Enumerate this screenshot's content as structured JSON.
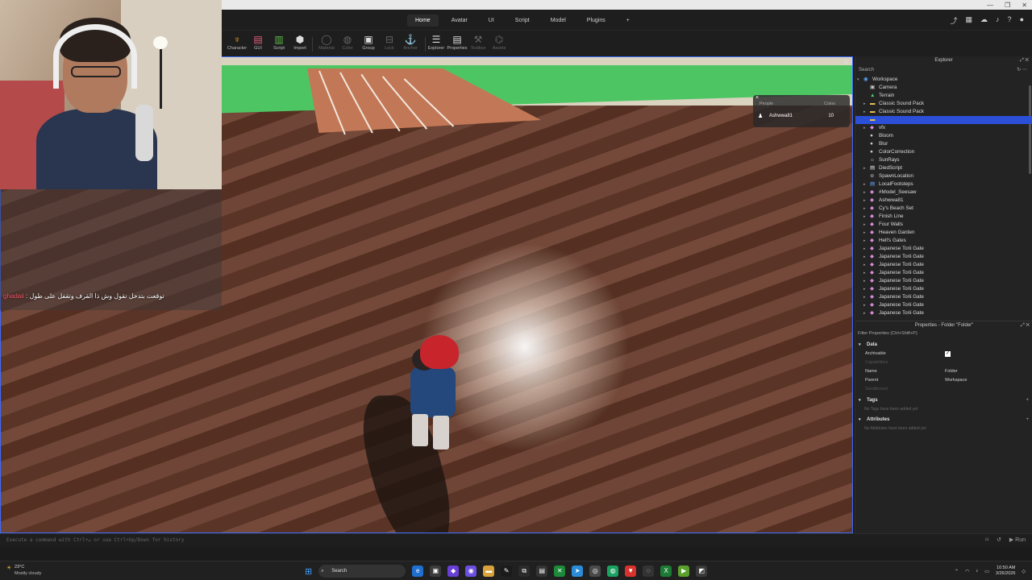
{
  "menu": {
    "tabs": [
      "Home",
      "Avatar",
      "UI",
      "Script",
      "Model",
      "Plugins",
      "+"
    ],
    "active_tab": "Home"
  },
  "toolbar": {
    "tools": [
      "Character",
      "GUI",
      "Script",
      "Import",
      "Material",
      "Color",
      "Group",
      "Lock",
      "Anchor",
      "Explorer",
      "Properties",
      "Toolbox",
      "Assets"
    ]
  },
  "players_overlay": {
    "close": "×",
    "people_header": "People",
    "coins_header": "Coins",
    "player_name": "Ashwwa81",
    "player_coins": "10"
  },
  "chat": {
    "username": "ghadaii",
    "message": ": توقعت بتدخل تقول وش ذا القرف وتقفل على طول"
  },
  "explorer": {
    "title": "Explorer",
    "search_label": "Search",
    "items": [
      {
        "label": "Workspace",
        "icon": "workspace-icon",
        "depth": 0,
        "arrow": "▾"
      },
      {
        "label": "Camera",
        "icon": "camera-icon",
        "depth": 1,
        "arrow": ""
      },
      {
        "label": "Terrain",
        "icon": "terrain-icon",
        "depth": 1,
        "arrow": ""
      },
      {
        "label": "Classic Sound Pack",
        "icon": "folder-icon",
        "depth": 1,
        "arrow": "▸"
      },
      {
        "label": "Classic Sound Pack",
        "icon": "folder-icon",
        "depth": 1,
        "arrow": "▸"
      },
      {
        "label": "",
        "icon": "folder-icon",
        "depth": 1,
        "arrow": "",
        "selected": true
      },
      {
        "label": "vfx",
        "icon": "model-icon",
        "depth": 1,
        "arrow": "▸"
      },
      {
        "label": "Bloom",
        "icon": "effect-icon",
        "depth": 1,
        "arrow": ""
      },
      {
        "label": "Blur",
        "icon": "effect-icon",
        "depth": 1,
        "arrow": ""
      },
      {
        "label": "ColorCorrection",
        "icon": "effect-icon",
        "depth": 1,
        "arrow": ""
      },
      {
        "label": "SunRays",
        "icon": "sun-icon",
        "depth": 1,
        "arrow": ""
      },
      {
        "label": "DiedScript",
        "icon": "script-icon",
        "depth": 1,
        "arrow": "▸"
      },
      {
        "label": "SpawnLocation",
        "icon": "spawn-icon",
        "depth": 1,
        "arrow": ""
      },
      {
        "label": "LocalFootsteps",
        "icon": "local-script-icon",
        "depth": 1,
        "arrow": "▸"
      },
      {
        "label": "#Model_Seesaw",
        "icon": "model-icon",
        "depth": 1,
        "arrow": "▸"
      },
      {
        "label": "Ashwwa81",
        "icon": "model-icon",
        "depth": 1,
        "arrow": "▸"
      },
      {
        "label": "Cy's Beach Set",
        "icon": "model-icon",
        "depth": 1,
        "arrow": "▸"
      },
      {
        "label": "Finish Line",
        "icon": "model-icon",
        "depth": 1,
        "arrow": "▸"
      },
      {
        "label": "Four Walls",
        "icon": "model-icon",
        "depth": 1,
        "arrow": "▸"
      },
      {
        "label": "Heaven Garden",
        "icon": "model-icon",
        "depth": 1,
        "arrow": "▸"
      },
      {
        "label": "Hell's Gates",
        "icon": "model-icon",
        "depth": 1,
        "arrow": "▸"
      },
      {
        "label": "Japanese Torii Gate",
        "icon": "model-icon",
        "depth": 1,
        "arrow": "▸"
      },
      {
        "label": "Japanese Torii Gate",
        "icon": "model-icon",
        "depth": 1,
        "arrow": "▸"
      },
      {
        "label": "Japanese Torii Gate",
        "icon": "model-icon",
        "depth": 1,
        "arrow": "▸"
      },
      {
        "label": "Japanese Torii Gate",
        "icon": "model-icon",
        "depth": 1,
        "arrow": "▸"
      },
      {
        "label": "Japanese Torii Gate",
        "icon": "model-icon",
        "depth": 1,
        "arrow": "▸"
      },
      {
        "label": "Japanese Torii Gate",
        "icon": "model-icon",
        "depth": 1,
        "arrow": "▸"
      },
      {
        "label": "Japanese Torii Gate",
        "icon": "model-icon",
        "depth": 1,
        "arrow": "▸"
      },
      {
        "label": "Japanese Torii Gate",
        "icon": "model-icon",
        "depth": 1,
        "arrow": "▸"
      },
      {
        "label": "Japanese Torii Gate",
        "icon": "model-icon",
        "depth": 1,
        "arrow": "▸"
      }
    ]
  },
  "properties": {
    "title": "Properties - Folder \"Folder\"",
    "filter_placeholder": "Filter Properties (Ctrl+Shift+P)",
    "data_section": "Data",
    "rows": [
      {
        "key": "Archivable",
        "value": "",
        "checkbox": true
      },
      {
        "key": "Capabilities",
        "value": "",
        "dim": true
      },
      {
        "key": "Name",
        "value": "Folder"
      },
      {
        "key": "Parent",
        "value": "Workspace"
      },
      {
        "key": "Sandboxed",
        "value": "",
        "dim": true
      }
    ],
    "tags_section": "Tags",
    "tags_empty": "No Tags have been added yet",
    "attributes_section": "Attributes",
    "attributes_empty": "No Attributes have been added yet"
  },
  "command_bar": {
    "placeholder": "Execute a command with Ctrl+↵ or use Ctrl+Up/Down for history",
    "run_label": "Run"
  },
  "taskbar": {
    "temperature": "23°C",
    "weather": "Mostly cloudy",
    "search_label": "Search",
    "time": "10:50 AM",
    "date": "3/26/2026"
  },
  "colors": {
    "accent": "#2b4fd6",
    "viewport_border": "#3d6bff",
    "chat_username": "#ff5a6b"
  }
}
